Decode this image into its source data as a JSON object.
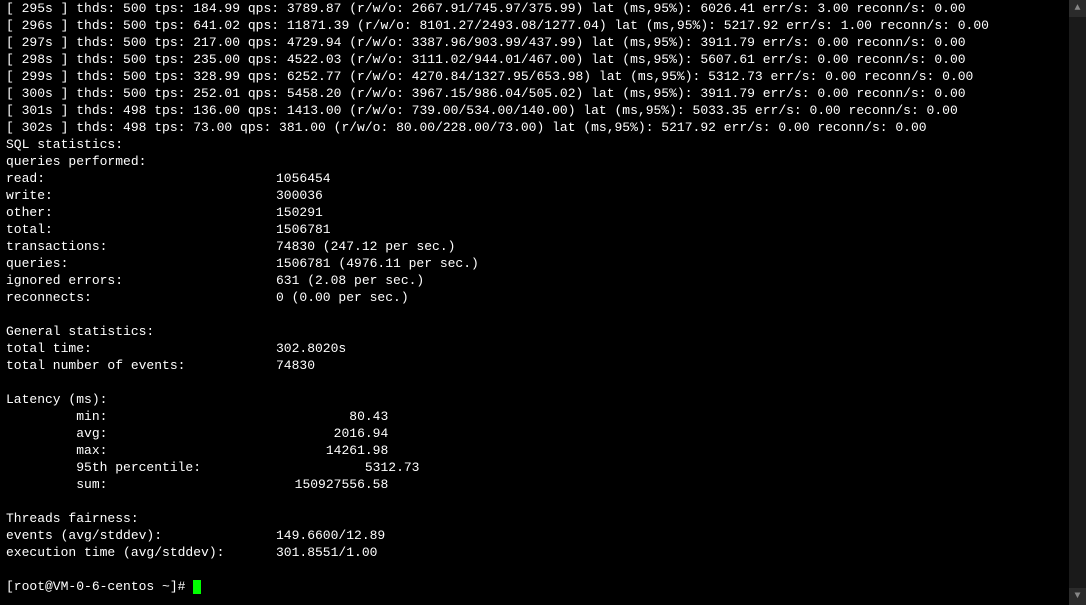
{
  "progress_lines": [
    "[ 295s ] thds: 500 tps: 184.99 qps: 3789.87 (r/w/o: 2667.91/745.97/375.99) lat (ms,95%): 6026.41 err/s: 3.00 reconn/s: 0.00",
    "[ 296s ] thds: 500 tps: 641.02 qps: 11871.39 (r/w/o: 8101.27/2493.08/1277.04) lat (ms,95%): 5217.92 err/s: 1.00 reconn/s: 0.00",
    "[ 297s ] thds: 500 tps: 217.00 qps: 4729.94 (r/w/o: 3387.96/903.99/437.99) lat (ms,95%): 3911.79 err/s: 0.00 reconn/s: 0.00",
    "[ 298s ] thds: 500 tps: 235.00 qps: 4522.03 (r/w/o: 3111.02/944.01/467.00) lat (ms,95%): 5607.61 err/s: 0.00 reconn/s: 0.00",
    "[ 299s ] thds: 500 tps: 328.99 qps: 6252.77 (r/w/o: 4270.84/1327.95/653.98) lat (ms,95%): 5312.73 err/s: 0.00 reconn/s: 0.00",
    "[ 300s ] thds: 500 tps: 252.01 qps: 5458.20 (r/w/o: 3967.15/986.04/505.02) lat (ms,95%): 3911.79 err/s: 0.00 reconn/s: 0.00",
    "[ 301s ] thds: 498 tps: 136.00 qps: 1413.00 (r/w/o: 739.00/534.00/140.00) lat (ms,95%): 5033.35 err/s: 0.00 reconn/s: 0.00",
    "[ 302s ] thds: 498 tps: 73.00 qps: 381.00 (r/w/o: 80.00/228.00/73.00) lat (ms,95%): 5217.92 err/s: 0.00 reconn/s: 0.00"
  ],
  "sql": {
    "header": "SQL statistics:",
    "queries_performed_label": "    queries performed:",
    "read_label": "        read:",
    "read_value": "1056454",
    "write_label": "        write:",
    "write_value": "300036",
    "other_label": "        other:",
    "other_value": "150291",
    "total_label": "        total:",
    "total_value": "1506781",
    "transactions_label": "    transactions:",
    "transactions_value": "74830   (247.12 per sec.)",
    "queries_label": "    queries:",
    "queries_value": "1506781 (4976.11 per sec.)",
    "ignored_label": "    ignored errors:",
    "ignored_value": "631     (2.08 per sec.)",
    "reconnects_label": "    reconnects:",
    "reconnects_value": "0       (0.00 per sec.)"
  },
  "general": {
    "header": "General statistics:",
    "total_time_label": "    total time:",
    "total_time_value": "302.8020s",
    "events_label": "    total number of events:",
    "events_value": "74830"
  },
  "latency": {
    "header": "Latency (ms):",
    "min_label": "         min:",
    "min_value": "                               80.43",
    "avg_label": "         avg:",
    "avg_value": "                             2016.94",
    "max_label": "         max:",
    "max_value": "                            14261.98",
    "p95_label": "         95th percentile:",
    "p95_value": "                     5312.73",
    "sum_label": "         sum:",
    "sum_value": "                        150927556.58"
  },
  "fairness": {
    "header": "Threads fairness:",
    "events_label": "    events (avg/stddev):",
    "events_value": "149.6600/12.89",
    "exec_label": "    execution time (avg/stddev):",
    "exec_value": "301.8551/1.00"
  },
  "prompt": "[root@VM-0-6-centos ~]# ",
  "scroll_up_glyph": "▲",
  "scroll_down_glyph": "▼"
}
